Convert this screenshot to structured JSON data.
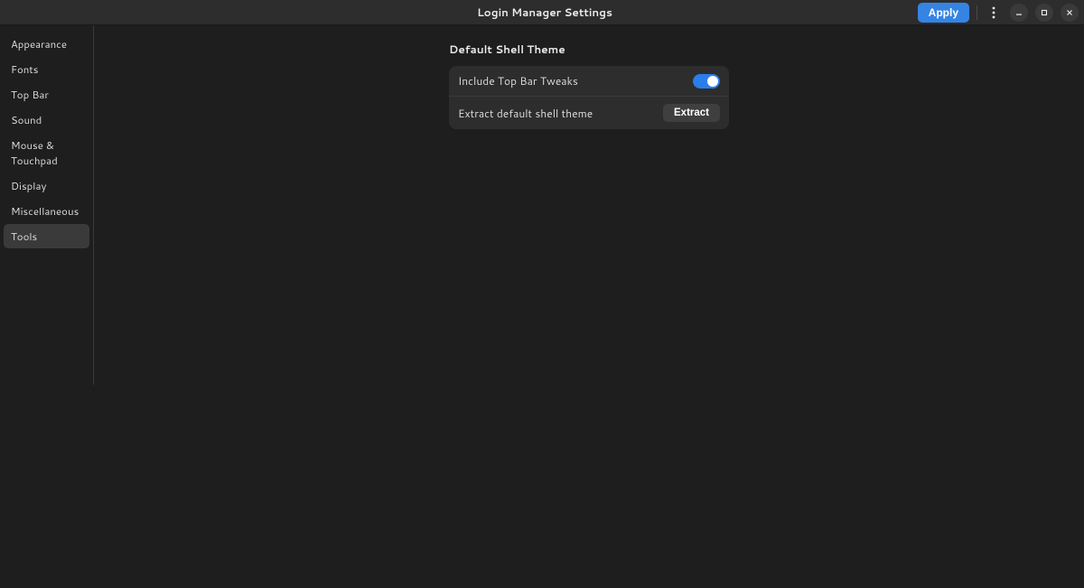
{
  "titlebar": {
    "title": "Login Manager Settings",
    "apply_label": "Apply"
  },
  "sidebar": {
    "items": [
      {
        "label": "Appearance"
      },
      {
        "label": "Fonts"
      },
      {
        "label": "Top Bar"
      },
      {
        "label": "Sound"
      },
      {
        "label": "Mouse & Touchpad"
      },
      {
        "label": "Display"
      },
      {
        "label": "Miscellaneous"
      },
      {
        "label": "Tools"
      }
    ],
    "selected_index": 7
  },
  "content": {
    "group_title": "Default Shell Theme",
    "rows": {
      "include_top_bar": {
        "label": "Include Top Bar Tweaks",
        "switch_on": true
      },
      "extract": {
        "label": "Extract default shell theme",
        "button_label": "Extract"
      }
    }
  },
  "colors": {
    "accent": "#3584e4",
    "background": "#1e1e1e",
    "panel": "#2d2d2d",
    "row_selected": "#3a3a3a"
  }
}
